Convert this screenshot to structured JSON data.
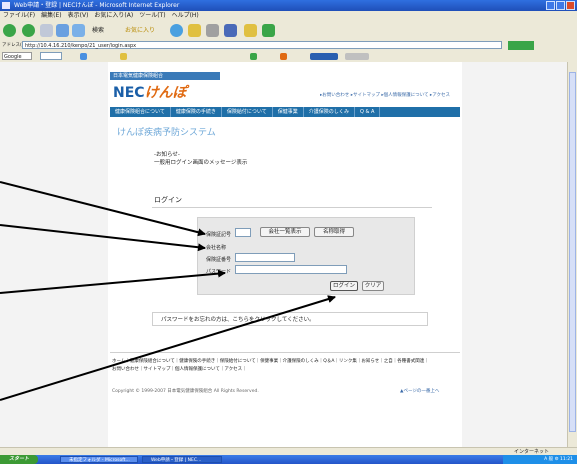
{
  "window": {
    "title": "Web申請・登録 | NECけんぽ - Microsoft Internet Explorer"
  },
  "menu": [
    "ファイル(F)",
    "編集(E)",
    "表示(V)",
    "お気に入り(A)",
    "ツール(T)",
    "ヘルプ(H)"
  ],
  "toolbar": {
    "search_label": "検索",
    "favorites_label": "お気に入り"
  },
  "addressbar": {
    "label": "アドレス(D)",
    "url": "http://10.4.16.210/kenpo/21_user/login.aspx",
    "go_label": "移動"
  },
  "linksbar": {
    "google_label": "Google"
  },
  "site": {
    "association": "日本電気健康保険組合",
    "logo_main": "NEC",
    "logo_sub": "けんぽ",
    "top_links": "▸お問い合わせ ▸サイトマップ ▸個人情報保護について ▸アクセス",
    "nav": [
      "健康保険組合について",
      "健康保険の手続き",
      "保険給付について",
      "保健事業",
      "介護保険のしくみ",
      "Q & A"
    ],
    "system_title": "けんぽ疾病予防システム"
  },
  "notice": {
    "title": "-お知らせ-",
    "body": "一般用ログイン画面のメッセージ表示"
  },
  "login": {
    "title": "ログイン",
    "insurer_label": "保険証記号",
    "company_list_button": "会社一覧表示",
    "name_button": "名称取得",
    "company_label": "会社名称",
    "number_label": "保険証番号",
    "password_label": "パスワード",
    "login_button": "ログイン",
    "clear_button": "クリア",
    "password_note": "パスワードをお忘れの方は、こちらをクリックしてください。"
  },
  "footer": {
    "links_line1": "ホーム｜健康保険組合について｜健康保険の手続き｜保険給付について｜保健事業｜介護保険のしくみ｜Q＆A｜リンク集｜お知らせ｜之自｜各種書式関連｜",
    "links_line2": "お問い合わせ｜サイトマップ｜個人情報保護について｜アクセス｜",
    "copyright": "Copyright © 1999-2007 日本電気健康保険組合 All Rights Reserved.",
    "page_top": "▲ページの一番上へ"
  },
  "status": {
    "zone": "インターネット"
  },
  "taskbar": {
    "start": "スタート",
    "tasks": [
      "未指定フォルダ - Microsoft...",
      "Web申請・登録 | NEC..."
    ],
    "tray": "A 般 ⚙ 11:21"
  },
  "colors": {
    "nav_blue": "#1f6fa8",
    "logo_blue": "#1b5fa8",
    "logo_orange": "#e06a12",
    "title_blue": "#6fa8d8"
  }
}
